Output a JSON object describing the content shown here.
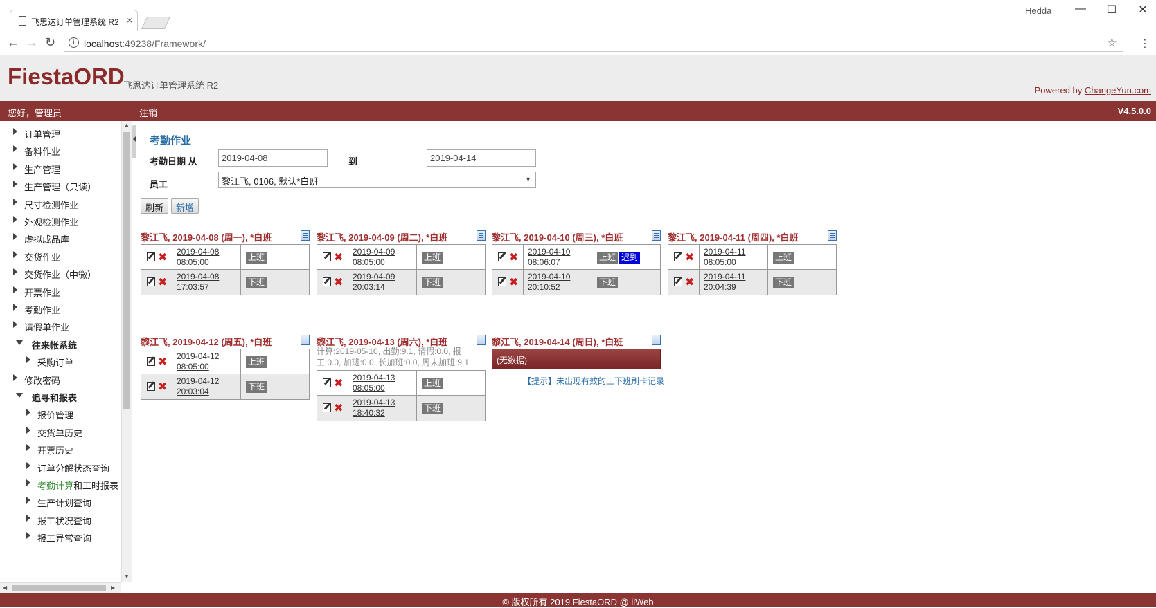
{
  "browser": {
    "tab_title": "飞思达订单管理系统 R2",
    "tab_close": "×",
    "user": "Hedda",
    "min": "—",
    "max": "☐",
    "close": "✕",
    "back": "←",
    "forward": "→",
    "reload": "↻",
    "url_host": "localhost",
    "url_rest": ":49238/Framework/",
    "star": "☆",
    "menu": "⋮",
    "info_glyph": "i"
  },
  "header": {
    "brand": "FiestaORD",
    "subtitle": "飞思达订单管理系统 R2",
    "powered_prefix": "Powered by ",
    "powered_link": "ChangeYun.com"
  },
  "topbar": {
    "greeting": "您好，管理员",
    "logout": "注销",
    "version": "V4.5.0.0"
  },
  "sidebar": {
    "items": [
      {
        "label": "订单管理",
        "level": 0,
        "expanded": false
      },
      {
        "label": "备料作业",
        "level": 0,
        "expanded": false
      },
      {
        "label": "生产管理",
        "level": 0,
        "expanded": false
      },
      {
        "label": "生产管理（只读）",
        "level": 0,
        "expanded": false
      },
      {
        "label": "尺寸检测作业",
        "level": 0,
        "expanded": false
      },
      {
        "label": "外观检测作业",
        "level": 0,
        "expanded": false
      },
      {
        "label": "虚拟成品库",
        "level": 0,
        "expanded": false
      },
      {
        "label": "交货作业",
        "level": 0,
        "expanded": false
      },
      {
        "label": "交货作业（中微）",
        "level": 0,
        "expanded": false
      },
      {
        "label": "开票作业",
        "level": 0,
        "expanded": false
      },
      {
        "label": "考勤作业",
        "level": 0,
        "expanded": false
      },
      {
        "label": "请假单作业",
        "level": 0,
        "expanded": false
      },
      {
        "label": "往来帐系统",
        "level": 0,
        "expanded": true
      },
      {
        "label": "采购订单",
        "level": 1,
        "expanded": false
      },
      {
        "label": "修改密码",
        "level": 0,
        "expanded": false
      },
      {
        "label": "追寻和报表",
        "level": 0,
        "expanded": true
      },
      {
        "label": "报价管理",
        "level": 1,
        "expanded": false
      },
      {
        "label": "交货单历史",
        "level": 1,
        "expanded": false
      },
      {
        "label": "开票历史",
        "level": 1,
        "expanded": false
      },
      {
        "label": "订单分解状态查询",
        "level": 1,
        "expanded": false
      },
      {
        "label": "考勤计算和工时报表",
        "level": 1,
        "expanded": false,
        "highlight": "考勤计算"
      },
      {
        "label": "生产计划查询",
        "level": 1,
        "expanded": false
      },
      {
        "label": "报工状况查询",
        "level": 1,
        "expanded": false
      },
      {
        "label": "报工异常查询",
        "level": 1,
        "expanded": false
      }
    ],
    "scroll_up": "▲",
    "scroll_down": "▼",
    "scroll_left": "◀",
    "scroll_right": "▶"
  },
  "main": {
    "title": "考勤作业",
    "date_from_label": "考勤日期 从",
    "date_from": "2019-04-08",
    "date_to_label": "到",
    "date_to": "2019-04-14",
    "employee_label": "员工",
    "employee": "黎江飞, 0106, 默认*白班",
    "select_caret": "▼",
    "refresh": "刷新",
    "add": "新增",
    "delete_glyph": "✖",
    "clock_in": "上班",
    "clock_out": "下班",
    "late": "迟到",
    "days": [
      {
        "header": "黎江飞, 2019-04-08 (周一), *白班",
        "records": [
          {
            "date": "2019-04-08",
            "time": "08:05:00",
            "type": "上班"
          },
          {
            "date": "2019-04-08",
            "time": "17:03:57",
            "type": "下班"
          }
        ]
      },
      {
        "header": "黎江飞, 2019-04-09 (周二), *白班",
        "records": [
          {
            "date": "2019-04-09",
            "time": "08:05:00",
            "type": "上班"
          },
          {
            "date": "2019-04-09",
            "time": "20:03:14",
            "type": "下班"
          }
        ]
      },
      {
        "header": "黎江飞, 2019-04-10 (周三), *白班",
        "records": [
          {
            "date": "2019-04-10",
            "time": "08:06:07",
            "type": "上班",
            "late": "迟到"
          },
          {
            "date": "2019-04-10",
            "time": "20:10:52",
            "type": "下班"
          }
        ]
      },
      {
        "header": "黎江飞, 2019-04-11 (周四), *白班",
        "records": [
          {
            "date": "2019-04-11",
            "time": "08:05:00",
            "type": "上班"
          },
          {
            "date": "2019-04-11",
            "time": "20:04:39",
            "type": "下班"
          }
        ]
      },
      {
        "header": "黎江飞, 2019-04-12 (周五), *白班",
        "records": [
          {
            "date": "2019-04-12",
            "time": "08:05:00",
            "type": "上班"
          },
          {
            "date": "2019-04-12",
            "time": "20:03:04",
            "type": "下班"
          }
        ]
      },
      {
        "header": "黎江飞, 2019-04-13 (周六), *白班",
        "stat": "计算:2019-05-10, 出勤:9.1, 请假:0.0, 报工:0.0, 加班:0.0, 长加班:0.0, 周末加班:9.1",
        "records": [
          {
            "date": "2019-04-13",
            "time": "08:05:00",
            "type": "上班"
          },
          {
            "date": "2019-04-13",
            "time": "18:40:32",
            "type": "下班"
          }
        ]
      },
      {
        "header": "黎江飞, 2019-04-14 (周日), *白班",
        "records": [],
        "nodata": "(无数据)",
        "hint": "【提示】未出现有效的上下班刷卡记录"
      }
    ]
  },
  "footer": {
    "copyright": "© 版权所有 2019 FiestaORD @ iiWeb"
  }
}
